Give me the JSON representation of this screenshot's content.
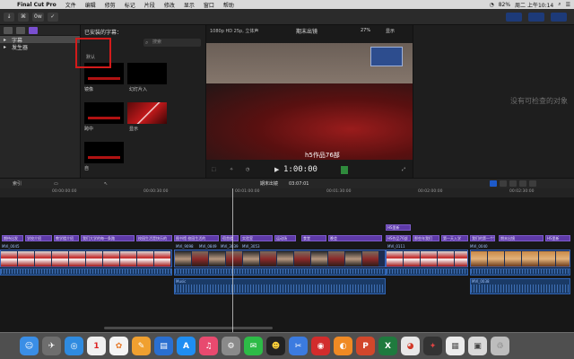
{
  "menubar": {
    "app_name": "Final Cut Pro",
    "menus": [
      "文件",
      "编辑",
      "修剪",
      "标记",
      "片段",
      "修改",
      "显示",
      "窗口",
      "帮助"
    ],
    "battery": "82%",
    "clock": "周二 上午10:14"
  },
  "toolbar": {
    "back_label": "0w"
  },
  "libraries": {
    "items": [
      {
        "label": "字幕",
        "selected": true
      },
      {
        "label": "发生器",
        "selected": false
      }
    ]
  },
  "browser": {
    "title": "已安装的字幕：",
    "search_placeholder": "搜索",
    "group_label": "默认",
    "thumbs": [
      {
        "label": "镜像"
      },
      {
        "label": "幻灯片入"
      },
      {
        "label": "跨中"
      },
      {
        "label": "显示"
      },
      {
        "label": "自"
      }
    ]
  },
  "viewer": {
    "format": "1080p HD 25p, 立体声",
    "project": "期末出镜",
    "zoom": "27%",
    "display_menu": "显示",
    "caption": "h5作品76部",
    "timecode": "1:00:00"
  },
  "inspector": {
    "empty_message": "没有可检查的对象"
  },
  "timeline": {
    "index_label": "索引",
    "project_name": "期末出镜",
    "duration": "03:07:01",
    "ruler_ticks": [
      "00:00:00:00",
      "00:00:30:00",
      "00:01:00:00",
      "00:01:30:00",
      "00:02:00:00",
      "00:02:30:00",
      "00:03:00:00"
    ],
    "title_clips": [
      "期待出发",
      "学校介绍",
      "教学楼介绍",
      "我们大学的每一条路",
      "我们走过",
      "校园生活是快乐的",
      "实验室",
      "图书馆 校园生活的",
      "宿舍楼",
      "食堂",
      "运动场",
      "期末出镜",
      "晚会",
      "HS里新",
      "HS作品76部",
      "那些年我们",
      "第一天入学",
      "我们的第一个学期"
    ],
    "video_clips": [
      "MVI_0045",
      "MVI_9098",
      "MVI_0849",
      "MVI_3039",
      "MVI_3053",
      "MVI_0111",
      "MVI_0040"
    ],
    "audio_clips": [
      "Music",
      "MVI_0038"
    ],
    "connected_title": "HS里新"
  },
  "dock": {
    "apps": [
      "Finder",
      "Launchpad",
      "Safari",
      "Calendar",
      "Photos",
      "Pages",
      "Keynote",
      "App Store",
      "Music",
      "System Preferences",
      "WeChat",
      "QQ",
      "Clipboard",
      "NetEase Music",
      "Firefox",
      "PowerPoint",
      "Excel",
      "Chrome",
      "Final Cut Pro",
      "Document",
      "Preview",
      "Trash"
    ]
  }
}
